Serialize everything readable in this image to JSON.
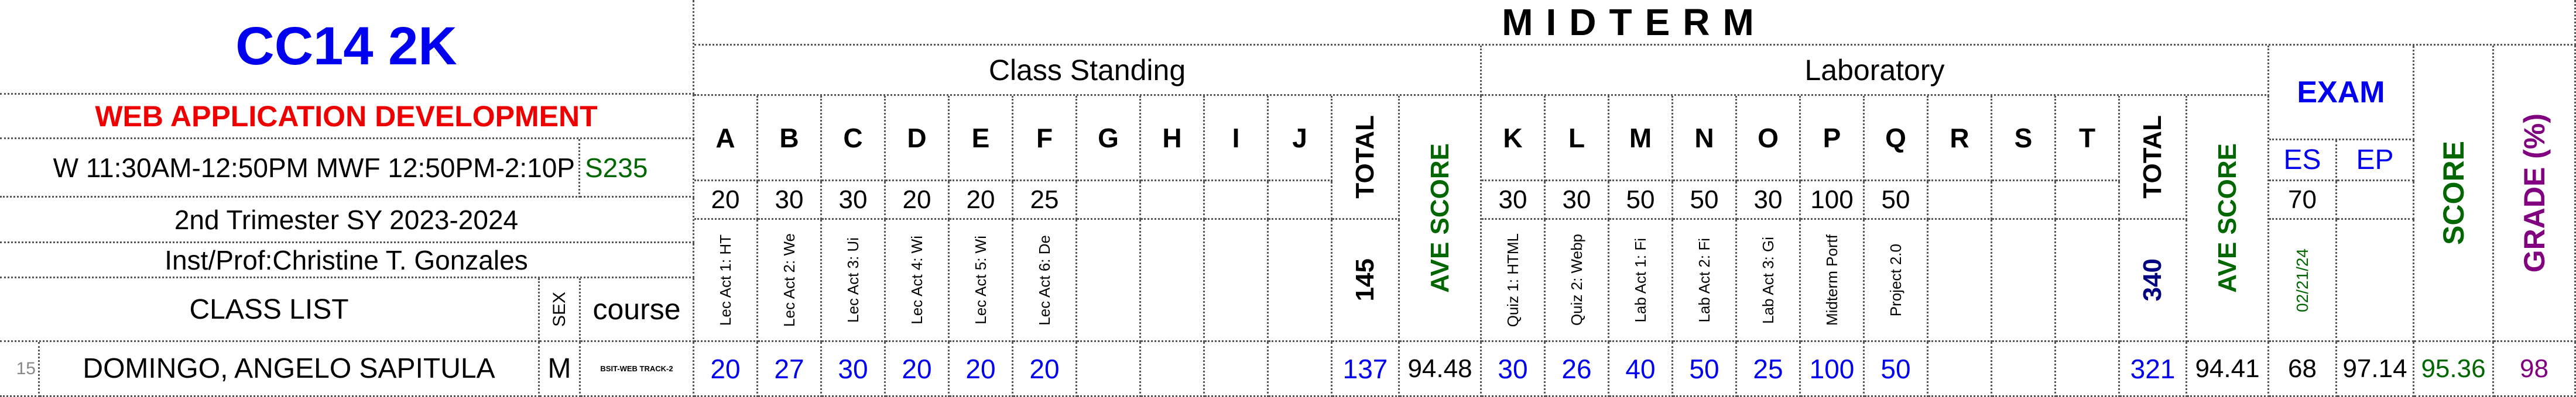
{
  "header": {
    "course_code": "CC14  2K",
    "subject": "WEB APPLICATION DEVELOPMENT",
    "schedule": "W 11:30AM-12:50PM  MWF 12:50PM-2:10P",
    "room": "S235",
    "term": "2nd Trimester SY 2023-2024",
    "instructor": "Inst/Prof:Christine T. Gonzales",
    "class_list": "CLASS LIST",
    "sex": "SEX",
    "course": "course"
  },
  "midterm": {
    "title": "MIDTERM",
    "class_standing": "Class Standing",
    "laboratory": "Laboratory",
    "exam": "EXAM"
  },
  "cs": {
    "letters": [
      "A",
      "B",
      "C",
      "D",
      "E",
      "F",
      "G",
      "H",
      "I",
      "J"
    ],
    "max": [
      "20",
      "30",
      "30",
      "20",
      "20",
      "25",
      "",
      "",
      "",
      ""
    ],
    "names": [
      "Lec Act 1: HT",
      "Lec Act 2: We",
      "Lec Act 3: Ui",
      "Lec Act 4: Wi",
      "Lec Act 5: Wi",
      "Lec Act 6: De",
      "",
      "",
      "",
      ""
    ],
    "total_label": "TOTAL",
    "total_max": "145",
    "ave_label": "AVE SCORE"
  },
  "lab": {
    "letters": [
      "K",
      "L",
      "M",
      "N",
      "O",
      "P",
      "Q",
      "R",
      "S",
      "T"
    ],
    "max": [
      "30",
      "30",
      "50",
      "50",
      "30",
      "100",
      "50",
      "",
      "",
      ""
    ],
    "names": [
      "Quiz 1: HTML",
      "Quiz 2: Webp",
      "Lab Act 1: Fi",
      "Lab Act 2: Fi",
      "Lab Act 3: Gi",
      "Midterm Portf",
      "Project 2.0",
      "",
      "",
      ""
    ],
    "total_label": "TOTAL",
    "total_max": "340",
    "ave_label": "AVE SCORE"
  },
  "exam": {
    "es": "ES",
    "ep": "EP",
    "es_max": "70",
    "es_date": "02/21/24",
    "score_label": "SCORE",
    "grade_label": "GRADE (%)"
  },
  "student": {
    "num": "15",
    "name": "DOMINGO, ANGELO SAPITULA",
    "sex": "M",
    "course": "BSIT-WEB TRACK-2",
    "cs_scores": [
      "20",
      "27",
      "30",
      "20",
      "20",
      "20",
      "",
      "",
      "",
      ""
    ],
    "cs_total": "137",
    "cs_ave": "94.48",
    "lab_scores": [
      "30",
      "26",
      "40",
      "50",
      "25",
      "100",
      "50",
      "",
      "",
      ""
    ],
    "lab_total": "321",
    "lab_ave": "94.41",
    "es": "68",
    "ep": "97.14",
    "score": "95.36",
    "grade": "98"
  },
  "colors": {
    "blue": "#0000ee",
    "red": "#ee0000",
    "green": "#006600",
    "purple": "#800080",
    "navy": "#000080"
  }
}
